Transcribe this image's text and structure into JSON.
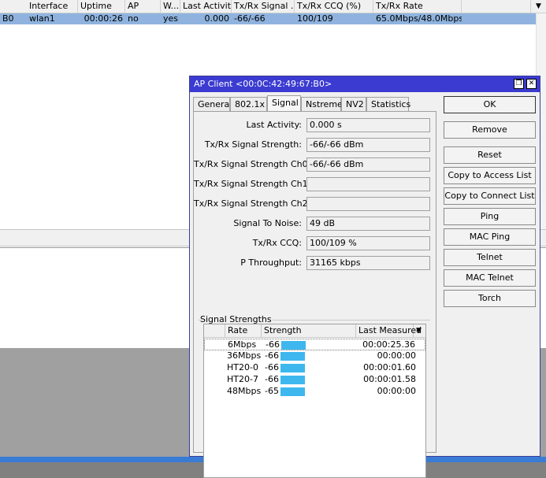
{
  "background": {
    "columns": [
      "Interface",
      "Uptime",
      "AP",
      "W...",
      "Last Activit...",
      "Tx/Rx Signal ...",
      "Tx/Rx CCQ (%)",
      "Tx/Rx Rate"
    ],
    "row": {
      "mac_tail": "B0",
      "interface": "wlan1",
      "uptime": "00:00:26",
      "ap": "no",
      "wds": "yes",
      "last_activity": "0.000",
      "signal": "-66/-66",
      "ccq": "100/109",
      "rate": "65.0Mbps/48.0Mbps"
    },
    "dropdown_icon": "chevron-down-icon"
  },
  "dialog": {
    "title": "AP Client <00:0C:42:49:67:B0>",
    "tabs": [
      "General",
      "802.1x",
      "Signal",
      "Nstreme",
      "NV2",
      "Statistics"
    ],
    "active_tab": "Signal",
    "fields": [
      {
        "label": "Last Activity:",
        "value": "0.000 s"
      },
      {
        "label": "Tx/Rx Signal Strength:",
        "value": "-66/-66 dBm"
      },
      {
        "label": "Tx/Rx Signal Strength Ch0:",
        "value": "-66/-66 dBm"
      },
      {
        "label": "Tx/Rx Signal Strength Ch1:",
        "value": ""
      },
      {
        "label": "Tx/Rx Signal Strength Ch2:",
        "value": ""
      },
      {
        "label": "Signal To Noise:",
        "value": "49 dB"
      },
      {
        "label": "Tx/Rx CCQ:",
        "value": "100/109 %"
      },
      {
        "label": "P Throughput:",
        "value": "31165 kbps"
      }
    ],
    "signal_strengths": {
      "legend": "Signal Strengths",
      "columns": [
        "Rate",
        "Strength",
        "Last Measured"
      ],
      "rows": [
        {
          "rate": "6Mbps",
          "strength": "-66",
          "last": "00:00:25.36",
          "selected": true
        },
        {
          "rate": "36Mbps",
          "strength": "-66",
          "last": "00:00:00"
        },
        {
          "rate": "HT20-0",
          "strength": "-66",
          "last": "00:00:01.60"
        },
        {
          "rate": "HT20-7",
          "strength": "-66",
          "last": "00:00:01.58"
        },
        {
          "rate": "48Mbps",
          "strength": "-65",
          "last": "00:00:00"
        }
      ]
    },
    "buttons": [
      "OK",
      "Remove",
      "Reset",
      "Copy to Access List",
      "Copy to Connect List",
      "Ping",
      "MAC Ping",
      "Telnet",
      "MAC Telnet",
      "Torch"
    ],
    "colors": {
      "titlebar": "#3b3bd1",
      "strength_bar": "#3eb7ef",
      "selected_row": "#8fb3de"
    }
  }
}
